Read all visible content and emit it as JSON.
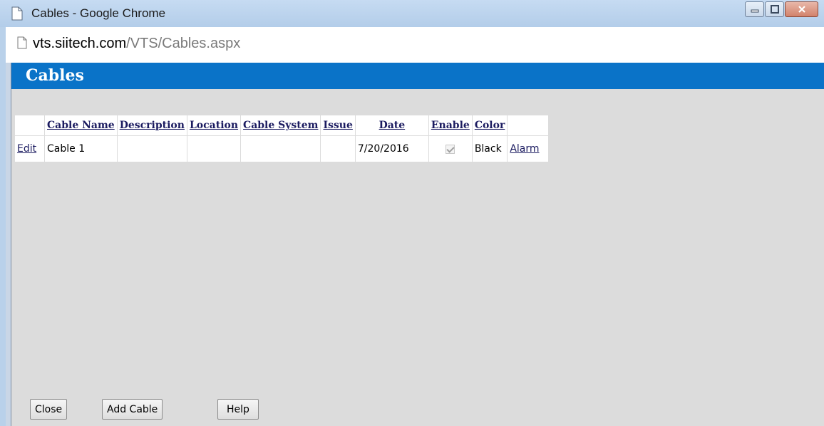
{
  "window": {
    "title": "Cables - Google Chrome",
    "controls": {
      "minimize": "minimize",
      "maximize": "maximize",
      "close": "close"
    }
  },
  "address": {
    "host": "vts.siitech.com",
    "path": "/VTS/Cables.aspx"
  },
  "page": {
    "title": "Cables"
  },
  "table": {
    "columns": [
      "",
      "Cable Name",
      "Description",
      "Location",
      "Cable System",
      "Issue",
      "Date",
      "Enable",
      "Color",
      ""
    ],
    "rows": [
      {
        "edit": "Edit",
        "cable_name": "Cable 1",
        "description": "",
        "location": "",
        "cable_system": "",
        "issue": "",
        "date": "7/20/2016",
        "enable": true,
        "color": "Black",
        "alarm": "Alarm"
      }
    ]
  },
  "buttons": {
    "close": "Close",
    "add_cable": "Add Cable",
    "help": "Help"
  },
  "colors": {
    "header_bar": "#0a73c8",
    "page_bg": "#dcdcdc",
    "link": "#1b1b60"
  }
}
